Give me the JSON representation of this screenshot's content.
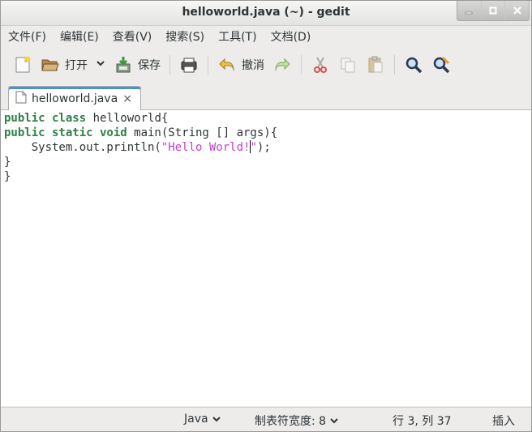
{
  "window": {
    "title": "helloworld.java (~) - gedit"
  },
  "menubar": {
    "items": [
      "文件(F)",
      "编辑(E)",
      "查看(V)",
      "搜索(S)",
      "工具(T)",
      "文档(D)"
    ]
  },
  "toolbar": {
    "open_label": "打开",
    "save_label": "保存",
    "undo_label": "撤消"
  },
  "tab": {
    "label": "helloworld.java",
    "close": "×"
  },
  "editor": {
    "lines": [
      {
        "kw1": "public class",
        "rest": " helloworld{"
      },
      {
        "kw1": "public static void",
        "rest": " main(String [] args){"
      },
      {
        "indent": "    System.out.println(",
        "str_a": "\"Hello World!",
        "str_b": "\"",
        "end": ");"
      },
      {
        "text": "}"
      },
      {
        "text": "}"
      }
    ]
  },
  "statusbar": {
    "language": "Java",
    "tab_width": "制表符宽度: 8",
    "position": "行 3, 列 37",
    "mode": "插入"
  }
}
